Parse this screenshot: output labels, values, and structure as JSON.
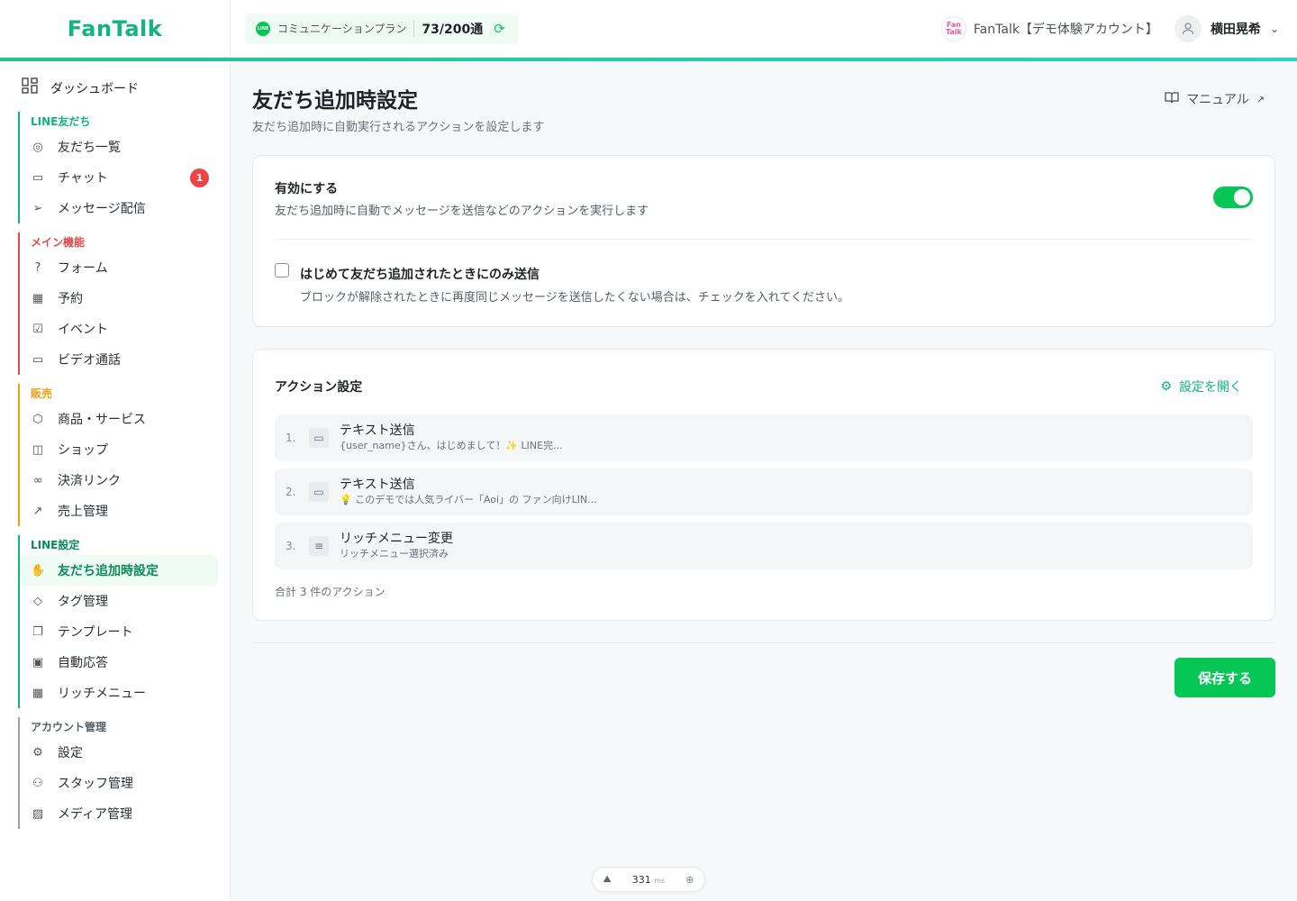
{
  "header": {
    "logo": "FanTalk",
    "plan_icon": "LINE",
    "plan_name": "コミュニケーションプラン",
    "plan_count": "73/200通",
    "account_avatar": "Fan Talk",
    "account_name": "FanTalk【デモ体験アカウント】",
    "user_name": "横田晃希"
  },
  "sidebar": {
    "dashboard": "ダッシュボード",
    "groups": [
      {
        "title": "LINE友だち",
        "color": "#0fb67e",
        "items": [
          {
            "label": "友だち一覧",
            "icon": "user-circle-icon"
          },
          {
            "label": "チャット",
            "icon": "chat-icon",
            "badge": "1"
          },
          {
            "label": "メッセージ配信",
            "icon": "send-icon"
          }
        ]
      },
      {
        "title": "メイン機能",
        "color": "#e5484d",
        "items": [
          {
            "label": "フォーム",
            "icon": "form-icon"
          },
          {
            "label": "予約",
            "icon": "calendar-icon"
          },
          {
            "label": "イベント",
            "icon": "event-icon"
          },
          {
            "label": "ビデオ通話",
            "icon": "video-icon"
          }
        ]
      },
      {
        "title": "販売",
        "color": "#e8a317",
        "items": [
          {
            "label": "商品・サービス",
            "icon": "box-icon"
          },
          {
            "label": "ショップ",
            "icon": "shop-icon"
          },
          {
            "label": "決済リンク",
            "icon": "link-icon"
          },
          {
            "label": "売上管理",
            "icon": "trend-icon"
          }
        ]
      },
      {
        "title": "LINE設定",
        "color": "#0fb67e",
        "items": [
          {
            "label": "友だち追加時設定",
            "icon": "hand-icon",
            "active": true
          },
          {
            "label": "タグ管理",
            "icon": "tag-icon"
          },
          {
            "label": "テンプレート",
            "icon": "template-icon"
          },
          {
            "label": "自動応答",
            "icon": "bot-icon"
          },
          {
            "label": "リッチメニュー",
            "icon": "grid-icon"
          }
        ]
      },
      {
        "title": "アカウント管理",
        "color": "#9aa0a6",
        "items": [
          {
            "label": "設定",
            "icon": "gear-icon"
          },
          {
            "label": "スタッフ管理",
            "icon": "users-icon"
          },
          {
            "label": "メディア管理",
            "icon": "image-icon"
          }
        ]
      }
    ]
  },
  "main": {
    "title": "友だち追加時設定",
    "subtitle": "友だち追加時に自動実行されるアクションを設定します",
    "manual": "マニュアル",
    "enable_label": "有効にする",
    "enable_desc": "友だち追加時に自動でメッセージを送信などのアクションを実行します",
    "enabled": true,
    "first_only_label": "はじめて友だち追加されたときにのみ送信",
    "first_only_desc": "ブロックが解除されたときに再度同じメッセージを送信したくない場合は、チェックを入れてください。",
    "first_only_checked": false,
    "actions_title": "アクション設定",
    "open_settings": "設定を開く",
    "actions": [
      {
        "num": "1.",
        "name": "テキスト送信",
        "detail": "{user_name}さん、はじめまして！✨ LINE完...",
        "icon": "chat-icon"
      },
      {
        "num": "2.",
        "name": "テキスト送信",
        "detail": "💡 このデモでは人気ライバー「Aoi」の ファン向けLIN...",
        "icon": "chat-icon"
      },
      {
        "num": "3.",
        "name": "リッチメニュー変更",
        "detail": "リッチメニュー選択済み",
        "icon": "menu-icon"
      }
    ],
    "total": "合計 3 件のアクション",
    "save": "保存する"
  },
  "perf": {
    "value": "331",
    "unit": "ms"
  }
}
